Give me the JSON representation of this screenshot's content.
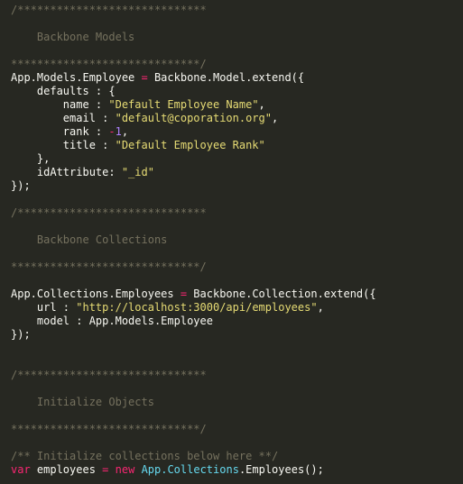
{
  "editor": {
    "theme_colors": {
      "background": "#272822",
      "text": "#f8f8f2",
      "comment": "#75715e",
      "operator": "#f92672",
      "string": "#e6db74",
      "number": "#ae81ff",
      "class": "#66d9ef"
    },
    "lines": [
      [
        {
          "t": "comment",
          "v": "/*****************************"
        }
      ],
      [],
      [
        {
          "t": "comment",
          "v": "    Backbone Models"
        }
      ],
      [],
      [
        {
          "t": "comment",
          "v": "*****************************/"
        }
      ],
      [
        {
          "t": "plain",
          "v": "App.Models.Employee "
        },
        {
          "t": "op",
          "v": "="
        },
        {
          "t": "plain",
          "v": " Backbone.Model.extend({"
        }
      ],
      [
        {
          "t": "plain",
          "v": "    defaults : {"
        }
      ],
      [
        {
          "t": "plain",
          "v": "        name : "
        },
        {
          "t": "string",
          "v": "\"Default Employee Name\""
        },
        {
          "t": "plain",
          "v": ","
        }
      ],
      [
        {
          "t": "plain",
          "v": "        email : "
        },
        {
          "t": "string",
          "v": "\"default@coporation.org\""
        },
        {
          "t": "plain",
          "v": ","
        }
      ],
      [
        {
          "t": "plain",
          "v": "        rank : "
        },
        {
          "t": "op",
          "v": "-"
        },
        {
          "t": "number",
          "v": "1"
        },
        {
          "t": "plain",
          "v": ","
        }
      ],
      [
        {
          "t": "plain",
          "v": "        title : "
        },
        {
          "t": "string",
          "v": "\"Default Employee Rank\""
        }
      ],
      [
        {
          "t": "plain",
          "v": "    },"
        }
      ],
      [
        {
          "t": "plain",
          "v": "    idAttribute: "
        },
        {
          "t": "string",
          "v": "\"_id\""
        }
      ],
      [
        {
          "t": "plain",
          "v": "});"
        }
      ],
      [],
      [
        {
          "t": "comment",
          "v": "/*****************************"
        }
      ],
      [],
      [
        {
          "t": "comment",
          "v": "    Backbone Collections"
        }
      ],
      [],
      [
        {
          "t": "comment",
          "v": "*****************************/"
        }
      ],
      [],
      [
        {
          "t": "plain",
          "v": "App.Collections.Employees "
        },
        {
          "t": "op",
          "v": "="
        },
        {
          "t": "plain",
          "v": " Backbone.Collection.extend({"
        }
      ],
      [
        {
          "t": "plain",
          "v": "    url : "
        },
        {
          "t": "string",
          "v": "\"http://localhost:3000/api/employees\""
        },
        {
          "t": "plain",
          "v": ","
        }
      ],
      [
        {
          "t": "plain",
          "v": "    model : App.Models.Employee"
        }
      ],
      [
        {
          "t": "plain",
          "v": "});"
        }
      ],
      [],
      [],
      [
        {
          "t": "comment",
          "v": "/*****************************"
        }
      ],
      [],
      [
        {
          "t": "comment",
          "v": "    Initialize Objects"
        }
      ],
      [],
      [
        {
          "t": "comment",
          "v": "*****************************/"
        }
      ],
      [],
      [
        {
          "t": "comment",
          "v": "/** Initialize collections below here **/"
        }
      ],
      [
        {
          "t": "keyword",
          "v": "var"
        },
        {
          "t": "plain",
          "v": " employees "
        },
        {
          "t": "op",
          "v": "="
        },
        {
          "t": "plain",
          "v": " "
        },
        {
          "t": "keyword",
          "v": "new"
        },
        {
          "t": "plain",
          "v": " "
        },
        {
          "t": "class",
          "v": "App.Collections"
        },
        {
          "t": "plain",
          "v": ".Employees();"
        }
      ]
    ]
  }
}
